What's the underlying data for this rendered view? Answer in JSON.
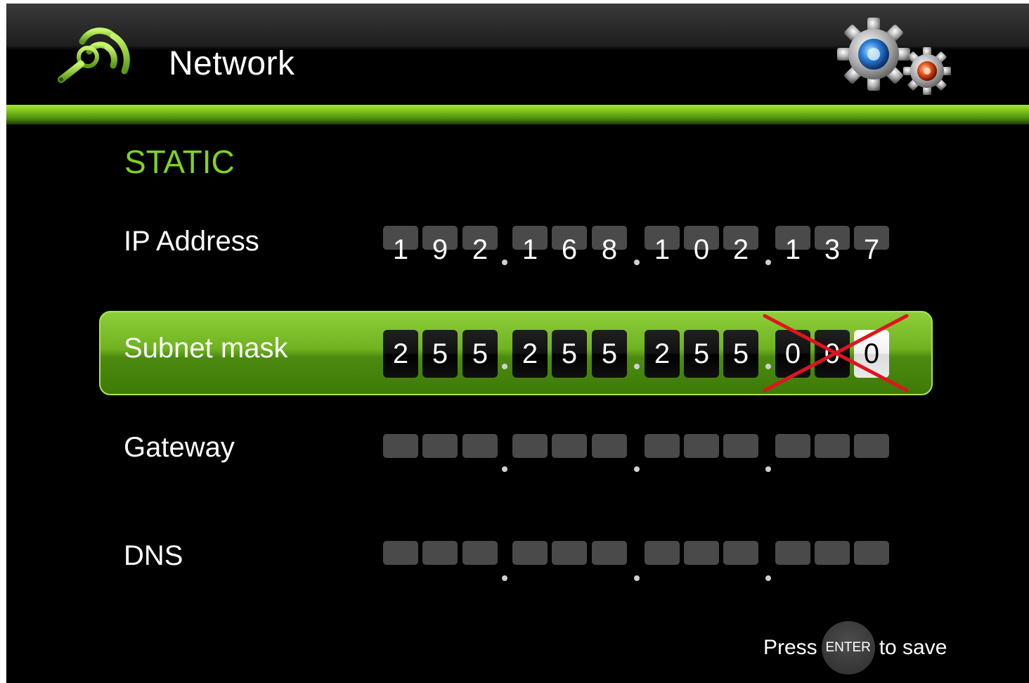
{
  "header": {
    "title": "Network",
    "logo_icon": "wireless-wrench-icon",
    "settings_icon": "gears-icon",
    "accent_color": "#7ed321"
  },
  "mode": "STATIC",
  "rows": {
    "ip_address": {
      "label": "IP Address",
      "digits": [
        "1",
        "9",
        "2",
        "1",
        "6",
        "8",
        "1",
        "0",
        "2",
        "1",
        "3",
        "7"
      ]
    },
    "subnet_mask": {
      "label": "Subnet mask",
      "digits": [
        "2",
        "5",
        "5",
        "2",
        "5",
        "5",
        "2",
        "5",
        "5",
        "0",
        "0",
        "0"
      ],
      "selected": true,
      "active_digit_index": 11
    },
    "gateway": {
      "label": "Gateway",
      "digits": [
        "",
        "",
        "",
        "",
        "",
        "",
        "",
        "",
        "",
        "",
        "",
        ""
      ]
    },
    "dns": {
      "label": "DNS",
      "digits": [
        "",
        "",
        "",
        "",
        "",
        "",
        "",
        "",
        "",
        "",
        "",
        ""
      ]
    }
  },
  "footer": {
    "press": "Press",
    "key": "ENTER",
    "suffix": "to save"
  },
  "annotation": {
    "type": "red-x-cross-out",
    "color": "#e0141e"
  }
}
